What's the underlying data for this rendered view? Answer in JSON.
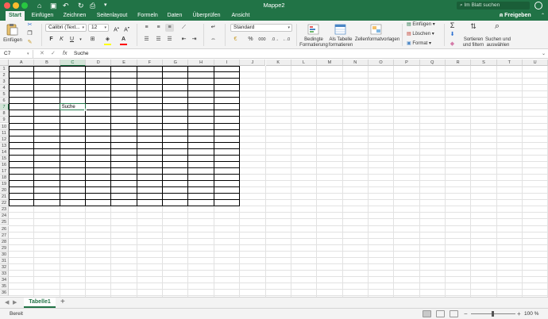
{
  "window": {
    "title": "Mappe2",
    "search_placeholder": "Im Blatt suchen"
  },
  "ribbon_tabs": [
    {
      "label": "Start",
      "active": true
    },
    {
      "label": "Einfügen"
    },
    {
      "label": "Zeichnen"
    },
    {
      "label": "Seitenlayout"
    },
    {
      "label": "Formeln"
    },
    {
      "label": "Daten"
    },
    {
      "label": "Überprüfen"
    },
    {
      "label": "Ansicht"
    }
  ],
  "share_label": "Freigeben",
  "ribbon": {
    "paste_label": "Einfügen",
    "font_name": "Calibri (Text...",
    "font_size": "12",
    "bold": "F",
    "italic": "K",
    "underline": "U",
    "number_format": "Standard",
    "percent": "%",
    "thousands": "000",
    "cond_format_label": "Bedingte Formatierung",
    "as_table_label": "Als Tabelle formatieren",
    "cell_styles_label": "Zellenformatvorlagen",
    "insert_label": "Einfügen",
    "delete_label": "Löschen",
    "format_label": "Format",
    "sort_label": "Sortieren und filtern",
    "find_label": "Suchen und auswählen",
    "colors": {
      "fill": "#ffff00",
      "font": "#ff0000"
    }
  },
  "formula_bar": {
    "name_box": "C7",
    "fx": "fx",
    "content": "Suche"
  },
  "grid": {
    "columns": [
      "A",
      "B",
      "C",
      "D",
      "E",
      "F",
      "G",
      "H",
      "I",
      "J",
      "K",
      "L",
      "M",
      "N",
      "O",
      "P",
      "Q",
      "R",
      "S",
      "T",
      "U"
    ],
    "row_count": 36,
    "selected_cell": "C7",
    "cells": [
      {
        "ref": "C7",
        "value": "Suche"
      }
    ]
  },
  "sheets": [
    {
      "name": "Tabelle1",
      "active": true
    }
  ],
  "status": {
    "text": "Bereit",
    "zoom": "100 %"
  },
  "theme": {
    "accent": "#217346"
  }
}
